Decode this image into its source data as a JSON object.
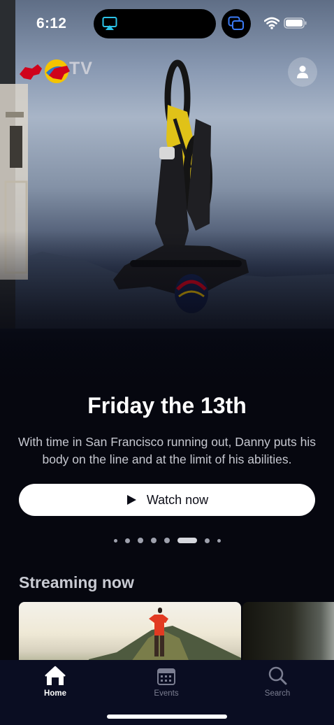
{
  "status_bar": {
    "time": "6:12",
    "icons": [
      "airplay-icon",
      "screen-mirroring-icon",
      "wifi-icon",
      "battery-icon"
    ]
  },
  "brand": {
    "logo_text": "TV",
    "icon": "red-bull-tv-logo"
  },
  "header": {
    "profile_icon": "profile-icon"
  },
  "feature": {
    "title": "Friday the 13th",
    "description": "With time in San Francisco running out, Danny puts his body on the line and at the limit of his abilities.",
    "watch_label": "Watch now",
    "pager": {
      "count": 8,
      "active_index": 5
    }
  },
  "section": {
    "title": "Streaming now"
  },
  "tab_bar": {
    "tabs": [
      {
        "label": "Home",
        "icon": "home-icon",
        "active": true
      },
      {
        "label": "Events",
        "icon": "calendar-icon",
        "active": false
      },
      {
        "label": "Search",
        "icon": "search-icon",
        "active": false
      }
    ]
  },
  "colors": {
    "background": "#06070f",
    "tab_bar": "#0a0d22",
    "button_bg": "#ffffff",
    "inactive_tab": "#7b7e91",
    "red_bull_red": "#d0021b",
    "red_bull_yellow": "#f5c400"
  }
}
